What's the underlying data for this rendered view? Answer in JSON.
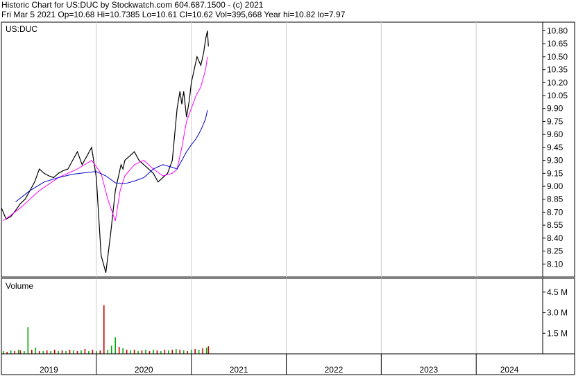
{
  "header": {
    "line1": "Historic Chart for US:DUC by Stockwatch.com 604.687.1500 - (c) 2021",
    "line2": "Fri Mar  5 2021   Op=10.68   Hi=10.7385   Lo=10.61   Cl=10.62   Vol=395,668   Year hi=10.82   lo=7.97"
  },
  "colors": {
    "price_line": "#000000",
    "ma_short": "#ff00ff",
    "ma_long": "#0000cc",
    "volume_up": "#00aa00",
    "volume_down": "#cc0000",
    "grid": "#cccccc",
    "frame": "#000000"
  },
  "chart_data": [
    {
      "type": "line",
      "panel": "price",
      "title": "US:DUC",
      "ylim": [
        7.95,
        10.9
      ],
      "yticks": [
        10.8,
        10.65,
        10.5,
        10.35,
        10.2,
        10.05,
        9.9,
        9.75,
        9.6,
        9.45,
        9.3,
        9.15,
        9.0,
        8.85,
        8.7,
        8.55,
        8.4,
        8.25,
        8.1
      ],
      "ytick_labels": [
        "10.80",
        "10.65",
        "10.50",
        "10.35",
        "10.20",
        "10.05",
        "9.90",
        "9.75",
        "9.60",
        "9.45",
        "9.30",
        "9.15",
        "9.00",
        "8.85",
        "8.70",
        "8.55",
        "8.40",
        "8.25",
        "8.10"
      ],
      "xlim": [
        2019.0,
        2024.7
      ],
      "series": [
        {
          "role": "price",
          "x": [
            2019.0,
            2019.05,
            2019.1,
            2019.15,
            2019.2,
            2019.25,
            2019.3,
            2019.35,
            2019.4,
            2019.45,
            2019.5,
            2019.55,
            2019.6,
            2019.65,
            2019.7,
            2019.75,
            2019.8,
            2019.85,
            2019.9,
            2019.95,
            2020.0,
            2020.05,
            2020.1,
            2020.15,
            2020.18,
            2020.2,
            2020.22,
            2020.24,
            2020.26,
            2020.28,
            2020.3,
            2020.35,
            2020.4,
            2020.45,
            2020.5,
            2020.55,
            2020.6,
            2020.65,
            2020.7,
            2020.75,
            2020.8,
            2020.85,
            2020.88,
            2020.9,
            2020.92,
            2020.95,
            2020.98,
            2021.0,
            2021.03,
            2021.06,
            2021.1,
            2021.13,
            2021.15,
            2021.17,
            2021.18
          ],
          "values": [
            8.75,
            8.62,
            8.65,
            8.72,
            8.8,
            8.85,
            8.95,
            9.05,
            9.2,
            9.15,
            9.12,
            9.1,
            9.15,
            9.18,
            9.2,
            9.3,
            9.4,
            9.25,
            9.35,
            9.45,
            9.1,
            8.2,
            8.0,
            8.45,
            8.75,
            8.95,
            9.05,
            9.15,
            9.25,
            9.2,
            9.3,
            9.35,
            9.4,
            9.3,
            9.25,
            9.2,
            9.15,
            9.05,
            9.1,
            9.15,
            9.3,
            9.9,
            10.1,
            9.95,
            10.1,
            9.8,
            10.0,
            10.2,
            10.35,
            10.5,
            10.4,
            10.55,
            10.7,
            10.8,
            10.62
          ]
        },
        {
          "role": "moving-average-short",
          "x": [
            2019.02,
            2019.2,
            2019.4,
            2019.6,
            2019.8,
            2019.95,
            2020.05,
            2020.12,
            2020.2,
            2020.25,
            2020.3,
            2020.4,
            2020.5,
            2020.6,
            2020.7,
            2020.8,
            2020.85,
            2020.9,
            2020.95,
            2021.0,
            2021.05,
            2021.1,
            2021.15,
            2021.17
          ],
          "values": [
            8.6,
            8.75,
            8.95,
            9.1,
            9.2,
            9.3,
            9.15,
            8.85,
            8.6,
            8.95,
            9.12,
            9.25,
            9.3,
            9.2,
            9.12,
            9.15,
            9.2,
            9.45,
            9.75,
            9.9,
            10.05,
            10.15,
            10.35,
            10.5
          ]
        },
        {
          "role": "moving-average-long",
          "x": [
            2019.15,
            2019.3,
            2019.45,
            2019.6,
            2019.75,
            2019.9,
            2020.0,
            2020.1,
            2020.2,
            2020.3,
            2020.4,
            2020.5,
            2020.6,
            2020.7,
            2020.8,
            2020.85,
            2020.9,
            2020.95,
            2021.0,
            2021.05,
            2021.1,
            2021.15,
            2021.17
          ],
          "values": [
            8.82,
            8.95,
            9.05,
            9.1,
            9.14,
            9.16,
            9.17,
            9.12,
            9.04,
            9.03,
            9.06,
            9.1,
            9.2,
            9.25,
            9.22,
            9.2,
            9.3,
            9.4,
            9.48,
            9.55,
            9.65,
            9.78,
            9.88
          ]
        }
      ]
    },
    {
      "type": "bar",
      "panel": "volume",
      "title": "Volume",
      "ylim": [
        0,
        5.5
      ],
      "yticks": [
        4.5,
        3.0,
        1.5
      ],
      "ytick_labels": [
        "4.5 M",
        "3.0 M",
        "1.5 M"
      ],
      "x": [
        2019.02,
        2019.06,
        2019.1,
        2019.14,
        2019.18,
        2019.2,
        2019.24,
        2019.28,
        2019.32,
        2019.36,
        2019.4,
        2019.44,
        2019.48,
        2019.52,
        2019.56,
        2019.6,
        2019.64,
        2019.68,
        2019.72,
        2019.76,
        2019.8,
        2019.84,
        2019.88,
        2019.92,
        2019.96,
        2020.0,
        2020.04,
        2020.08,
        2020.12,
        2020.16,
        2020.2,
        2020.24,
        2020.28,
        2020.32,
        2020.36,
        2020.4,
        2020.44,
        2020.48,
        2020.52,
        2020.56,
        2020.6,
        2020.64,
        2020.68,
        2020.72,
        2020.76,
        2020.8,
        2020.84,
        2020.88,
        2020.92,
        2020.96,
        2021.0,
        2021.04,
        2021.08,
        2021.12,
        2021.16,
        2021.18
      ],
      "values": [
        0.2,
        0.15,
        0.25,
        0.2,
        0.3,
        0.25,
        0.2,
        1.95,
        0.3,
        0.45,
        0.2,
        0.2,
        0.25,
        0.2,
        0.3,
        0.2,
        0.25,
        0.2,
        0.3,
        0.25,
        0.2,
        0.25,
        0.35,
        0.2,
        0.3,
        0.2,
        0.25,
        3.55,
        0.3,
        0.6,
        1.2,
        0.5,
        0.4,
        0.3,
        0.25,
        0.3,
        0.2,
        0.25,
        0.3,
        0.2,
        0.3,
        0.25,
        0.2,
        0.3,
        0.25,
        0.3,
        0.35,
        0.3,
        0.25,
        0.2,
        0.3,
        0.35,
        0.3,
        0.4,
        0.45,
        0.55
      ],
      "colors": [
        "up",
        "down",
        "up",
        "down",
        "up",
        "down",
        "up",
        "up",
        "down",
        "up",
        "down",
        "up",
        "down",
        "up",
        "down",
        "up",
        "down",
        "up",
        "down",
        "up",
        "down",
        "up",
        "down",
        "up",
        "down",
        "up",
        "down",
        "down",
        "up",
        "up",
        "up",
        "down",
        "up",
        "down",
        "up",
        "down",
        "up",
        "down",
        "up",
        "down",
        "up",
        "down",
        "up",
        "down",
        "up",
        "down",
        "up",
        "down",
        "up",
        "down",
        "up",
        "down",
        "up",
        "down",
        "up",
        "down"
      ]
    }
  ],
  "x_axis": {
    "labels": [
      "2019",
      "2020",
      "2021",
      "2022",
      "2023",
      "2024"
    ],
    "boundaries": [
      2019.0,
      2020.0,
      2021.0,
      2022.0,
      2023.0,
      2024.0,
      2024.7
    ]
  }
}
